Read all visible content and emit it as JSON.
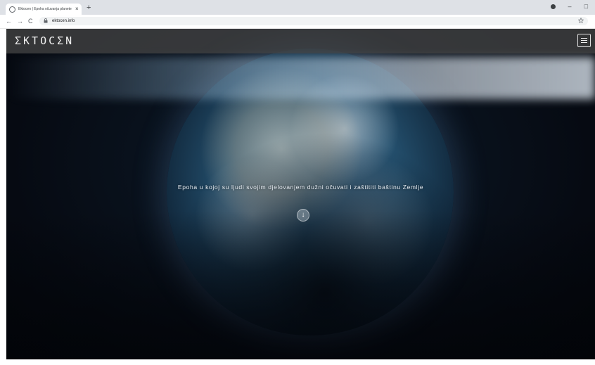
{
  "browser": {
    "tab_title": "Ektocen | Epoha očuvanja planete",
    "tab_close": "×",
    "new_tab": "+",
    "back": "←",
    "forward": "→",
    "reload": "C",
    "url": "ektocen.info",
    "minimize": "–",
    "restore": "□"
  },
  "site": {
    "logo": "ΣKTOCΣN",
    "tagline": "Epoha u kojoj su ljudi svojim djelovanjem dužni očuvati i zaštititi baštinu Zemlje",
    "scroll_icon_glyph": "↓"
  },
  "icons": {
    "lock": "lock-icon",
    "star": "star-icon",
    "menu": "hamburger-icon",
    "scroll": "arrow-down-icon"
  },
  "colors": {
    "header_bg": "#464646",
    "page_bg": "#060a12",
    "text": "#e8eef4"
  }
}
